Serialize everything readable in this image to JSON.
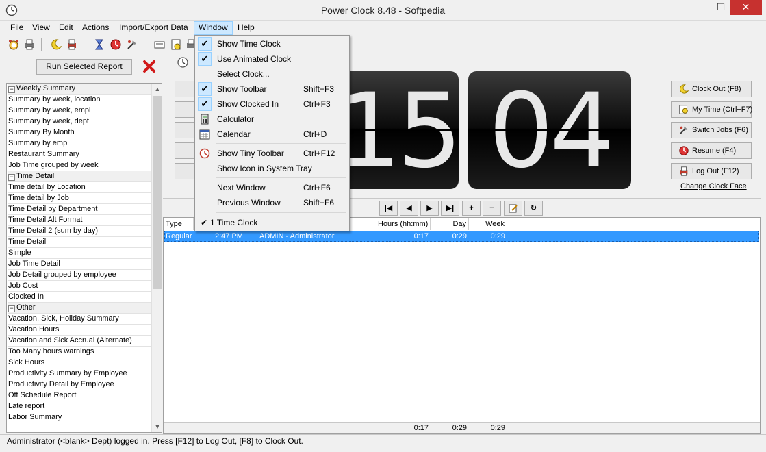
{
  "window": {
    "title": "Power Clock 8.48 - Softpedia",
    "minimize": "–",
    "maximize": "☐",
    "close": "✕"
  },
  "menubar": [
    "File",
    "Edit",
    "Actions",
    "Import/Export Data",
    "Window",
    "Help"
  ],
  "menu_view": "View",
  "left_panel": {
    "run_report_label": "Run Selected Report",
    "reports": [
      {
        "text": "Weekly Summary",
        "group": true
      },
      {
        "text": "Summary by week, location"
      },
      {
        "text": "Summary by week, empl"
      },
      {
        "text": "Summary by week, dept"
      },
      {
        "text": "Summary By Month"
      },
      {
        "text": "Summary by empl"
      },
      {
        "text": "Restaurant Summary"
      },
      {
        "text": "Job Time grouped by week"
      },
      {
        "text": "Time Detail",
        "group": true
      },
      {
        "text": "Time detail by Location"
      },
      {
        "text": "Time detail by Job"
      },
      {
        "text": "Time Detail by Department"
      },
      {
        "text": "Time Detail Alt Format"
      },
      {
        "text": "Time Detail 2 (sum by day)"
      },
      {
        "text": "Time Detail"
      },
      {
        "text": "Simple"
      },
      {
        "text": "Job Time Detail"
      },
      {
        "text": "Job Detail grouped by employee"
      },
      {
        "text": "Job Cost"
      },
      {
        "text": "Clocked In"
      },
      {
        "text": "Other",
        "group": true
      },
      {
        "text": "Vacation, Sick, Holiday Summary"
      },
      {
        "text": "Vacation Hours"
      },
      {
        "text": "Vacation and Sick Accrual (Alternate)"
      },
      {
        "text": "Too Many hours warnings"
      },
      {
        "text": "Sick Hours"
      },
      {
        "text": "Productivity Summary by Employee"
      },
      {
        "text": "Productivity Detail by Employee"
      },
      {
        "text": "Off Schedule Report"
      },
      {
        "text": "Late report"
      },
      {
        "text": "Labor Summary"
      }
    ]
  },
  "clock": {
    "hours": "15",
    "minutes": "04"
  },
  "right_buttons": [
    {
      "label": "Clock Out (F8)",
      "icon": "moon-icon"
    },
    {
      "label": "My Time (Ctrl+F7)",
      "icon": "my-time-icon"
    },
    {
      "label": "Switch Jobs (F6)",
      "icon": "switch-jobs-icon"
    },
    {
      "label": "Resume (F4)",
      "icon": "resume-icon"
    },
    {
      "label": "Log Out (F12)",
      "icon": "log-out-icon"
    }
  ],
  "change_clock_face": "Change Clock Face",
  "nav_buttons": [
    "|◀",
    "◀",
    "▶",
    "▶|",
    "+",
    "−",
    "edit-record-icon",
    "↻"
  ],
  "grid": {
    "headers": [
      "Type",
      "Hours (hh:mm)",
      "Day",
      "Week"
    ],
    "row": {
      "type": "Regular",
      "time": "2:47 PM",
      "employee": "ADMIN - Administrator",
      "hours": "0:17",
      "day": "0:29",
      "week": "0:29"
    },
    "totals": {
      "hours": "0:17",
      "day": "0:29",
      "week": "0:29"
    }
  },
  "status": "Administrator (<blank> Dept) logged in.  Press [F12] to Log Out, [F8] to Clock Out.",
  "window_menu": {
    "items": [
      {
        "label": "Show Time Clock",
        "checked": true
      },
      {
        "label": "Use Animated Clock",
        "checked": true
      },
      {
        "label": "Select Clock..."
      },
      {
        "label": "Show Toolbar",
        "shortcut": "Shift+F3",
        "checked": true
      },
      {
        "label": "Show Clocked In",
        "shortcut": "Ctrl+F3",
        "checked": true
      },
      {
        "label": "Calculator",
        "icon": "calculator-icon"
      },
      {
        "label": "Calendar",
        "shortcut": "Ctrl+D",
        "icon": "calendar-icon"
      },
      {
        "label": "Show Tiny Toolbar",
        "shortcut": "Ctrl+F12",
        "icon": "tiny-toolbar-icon"
      },
      {
        "label": "Show Icon in System Tray"
      },
      {
        "label": "Next Window",
        "shortcut": "Ctrl+F6"
      },
      {
        "label": "Previous Window",
        "shortcut": "Shift+F6"
      },
      {
        "label": "1 Time Clock",
        "checked": true
      }
    ]
  },
  "colors": {
    "selection": "#3399ff",
    "menu_highlight": "#cce8ff",
    "close_button": "#c7312f"
  }
}
